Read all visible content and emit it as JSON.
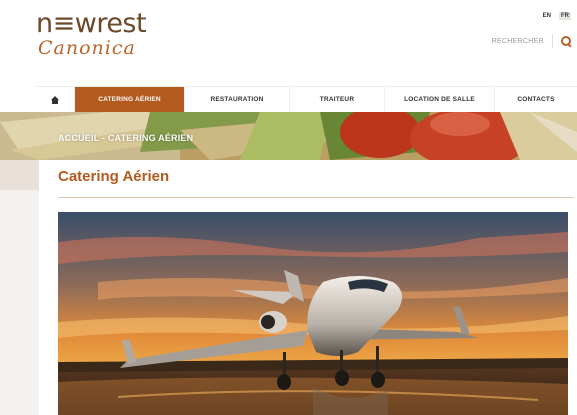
{
  "brand": {
    "name_top": "n≡wrest",
    "name_bottom": "Canonica"
  },
  "lang": {
    "en": "EN",
    "fr": "FR"
  },
  "search": {
    "label": "RECHERCHER"
  },
  "nav": {
    "home": "home",
    "items": [
      {
        "label": "CATERING AÉRIEN",
        "active": true
      },
      {
        "label": "RESTAURATION",
        "active": false
      },
      {
        "label": "TRAITEUR",
        "active": false
      },
      {
        "label": "LOCATION DE SALLE",
        "active": false
      },
      {
        "label": "CONTACTS",
        "active": false
      }
    ]
  },
  "banner": {
    "breadcrumb": "ACCUEIL - CATERING AÉRIEN"
  },
  "main": {
    "title": "Catering Aérien"
  },
  "colors": {
    "accent": "#b35a1f",
    "brand_brown": "#6b4a2b"
  }
}
